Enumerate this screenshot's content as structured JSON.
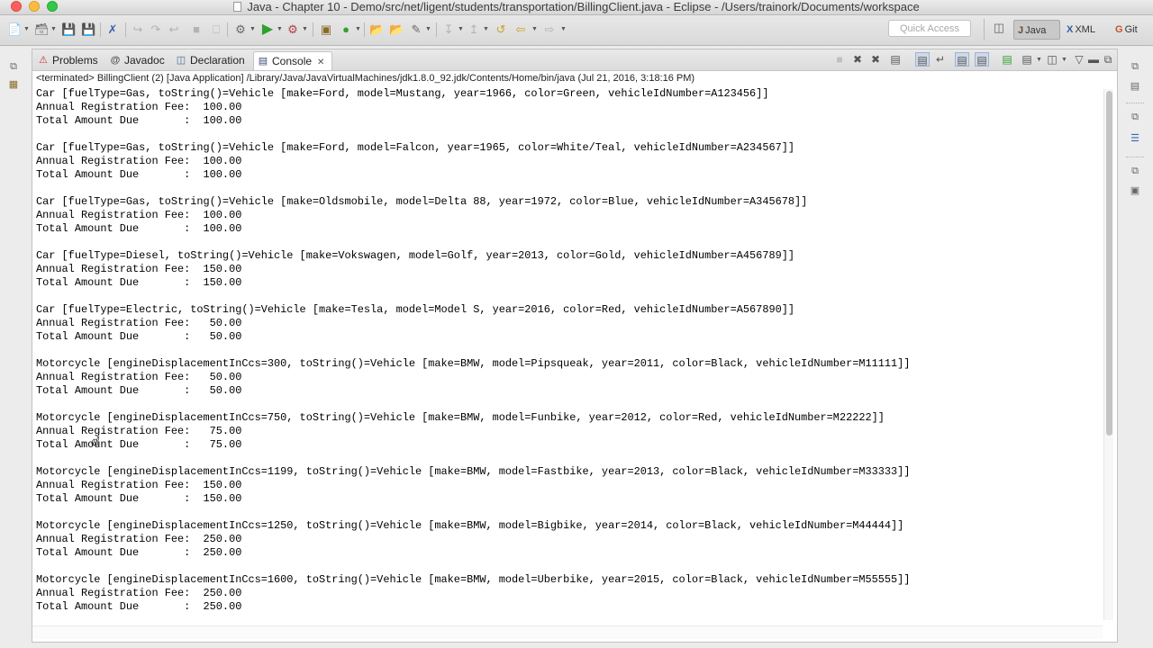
{
  "window": {
    "title": "Java - Chapter 10 - Demo/src/net/ligent/students/transportation/BillingClient.java - Eclipse - /Users/trainork/Documents/workspace"
  },
  "toolbar": {
    "quick_access_placeholder": "Quick Access",
    "perspectives": [
      {
        "label": "Java",
        "icon": "J"
      },
      {
        "label": "XML",
        "icon": "X"
      },
      {
        "label": "Git",
        "icon": "G"
      }
    ]
  },
  "tabs": [
    {
      "label": "Problems",
      "icon": "problems-icon"
    },
    {
      "label": "Javadoc",
      "icon": "javadoc-icon"
    },
    {
      "label": "Declaration",
      "icon": "declaration-icon"
    },
    {
      "label": "Console",
      "icon": "console-icon",
      "active": true
    }
  ],
  "console": {
    "status": "<terminated> BillingClient (2) [Java Application] /Library/Java/JavaVirtualMachines/jdk1.8.0_92.jdk/Contents/Home/bin/java (Jul 21, 2016, 3:18:16 PM)",
    "lines": [
      "Car [fuelType=Gas, toString()=Vehicle [make=Ford, model=Mustang, year=1966, color=Green, vehicleIdNumber=A123456]]",
      "Annual Registration Fee:  100.00",
      "Total Amount Due       :  100.00",
      "",
      "Car [fuelType=Gas, toString()=Vehicle [make=Ford, model=Falcon, year=1965, color=White/Teal, vehicleIdNumber=A234567]]",
      "Annual Registration Fee:  100.00",
      "Total Amount Due       :  100.00",
      "",
      "Car [fuelType=Gas, toString()=Vehicle [make=Oldsmobile, model=Delta 88, year=1972, color=Blue, vehicleIdNumber=A345678]]",
      "Annual Registration Fee:  100.00",
      "Total Amount Due       :  100.00",
      "",
      "Car [fuelType=Diesel, toString()=Vehicle [make=Vokswagen, model=Golf, year=2013, color=Gold, vehicleIdNumber=A456789]]",
      "Annual Registration Fee:  150.00",
      "Total Amount Due       :  150.00",
      "",
      "Car [fuelType=Electric, toString()=Vehicle [make=Tesla, model=Model S, year=2016, color=Red, vehicleIdNumber=A567890]]",
      "Annual Registration Fee:   50.00",
      "Total Amount Due       :   50.00",
      "",
      "Motorcycle [engineDisplacementInCcs=300, toString()=Vehicle [make=BMW, model=Pipsqueak, year=2011, color=Black, vehicleIdNumber=M11111]]",
      "Annual Registration Fee:   50.00",
      "Total Amount Due       :   50.00",
      "",
      "Motorcycle [engineDisplacementInCcs=750, toString()=Vehicle [make=BMW, model=Funbike, year=2012, color=Red, vehicleIdNumber=M22222]]",
      "Annual Registration Fee:   75.00",
      "Total Amount Due       :   75.00",
      "",
      "Motorcycle [engineDisplacementInCcs=1199, toString()=Vehicle [make=BMW, model=Fastbike, year=2013, color=Black, vehicleIdNumber=M33333]]",
      "Annual Registration Fee:  150.00",
      "Total Amount Due       :  150.00",
      "",
      "Motorcycle [engineDisplacementInCcs=1250, toString()=Vehicle [make=BMW, model=Bigbike, year=2014, color=Black, vehicleIdNumber=M44444]]",
      "Annual Registration Fee:  250.00",
      "Total Amount Due       :  250.00",
      "",
      "Motorcycle [engineDisplacementInCcs=1600, toString()=Vehicle [make=BMW, model=Uberbike, year=2015, color=Black, vehicleIdNumber=M55555]]",
      "Annual Registration Fee:  250.00",
      "Total Amount Due       :  250.00"
    ]
  }
}
